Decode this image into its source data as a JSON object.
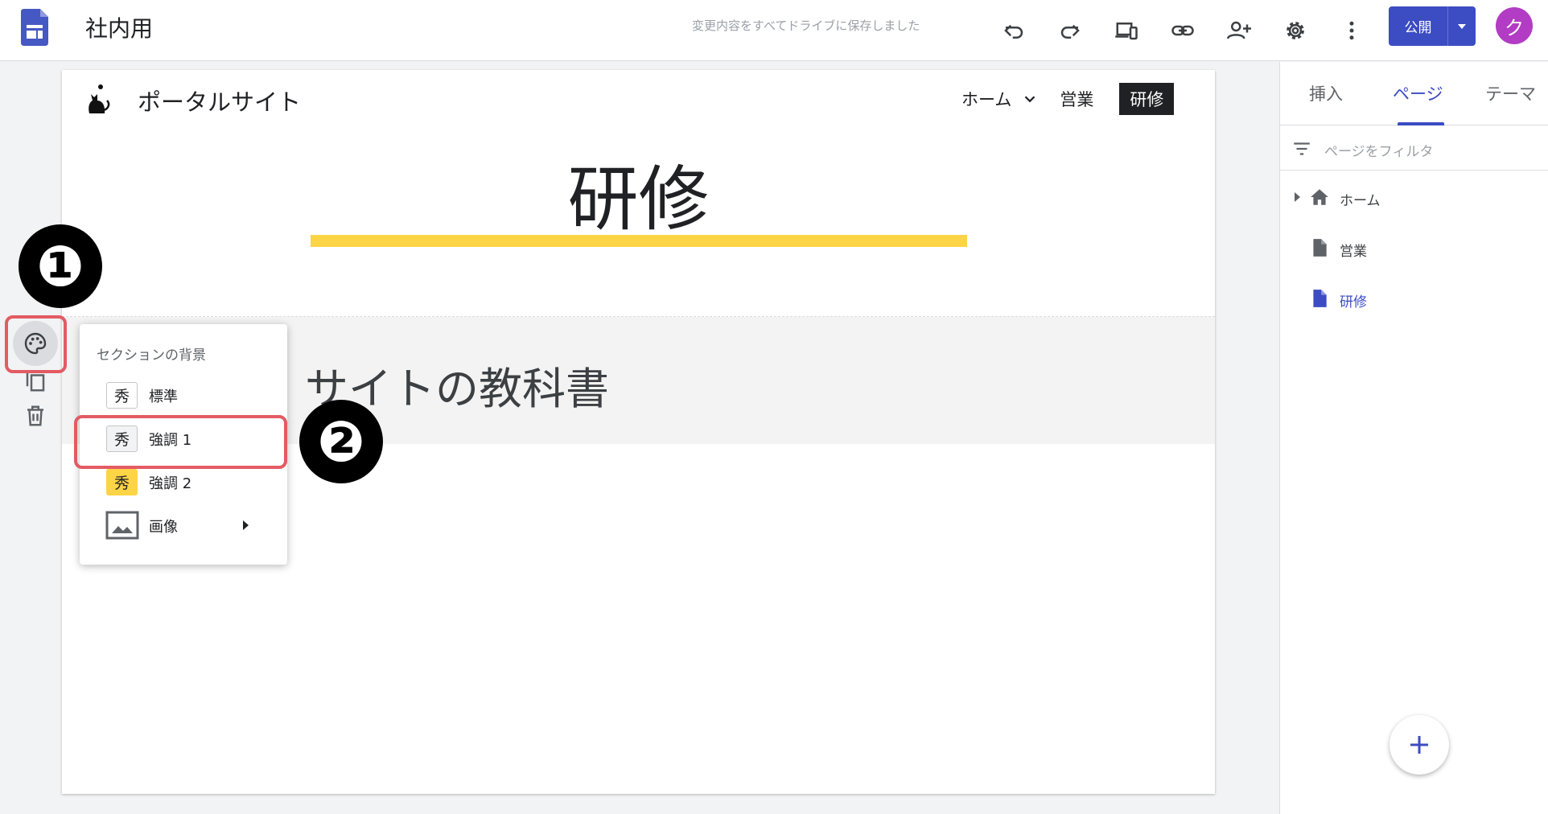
{
  "topbar": {
    "doc_title": "社内用",
    "save_status": "変更内容をすべてドライブに保存しました",
    "publish_label": "公開",
    "avatar_initial": "ク",
    "icons": [
      "undo-icon",
      "redo-icon",
      "preview-devices-icon",
      "link-icon",
      "share-icon",
      "settings-icon",
      "more-icon"
    ]
  },
  "site": {
    "name": "ポータルサイト",
    "nav": {
      "home": "ホーム",
      "sales": "営業",
      "training": "研修"
    },
    "page_heading": "研修",
    "section_text": "サイトの教科書"
  },
  "background_menu": {
    "heading": "セクションの背景",
    "items": [
      {
        "swatch": "秀",
        "label": "標準"
      },
      {
        "swatch": "秀",
        "label": "強調 1"
      },
      {
        "swatch": "秀",
        "label": "強調 2"
      },
      {
        "label": "画像"
      }
    ]
  },
  "markers": {
    "one": "❶",
    "two": "❷"
  },
  "side_panel": {
    "tabs": [
      "挿入",
      "ページ",
      "テーマ"
    ],
    "active_tab": "ページ",
    "filter_placeholder": "ページをフィルタ",
    "pages": [
      {
        "label": "ホーム",
        "icon": "home-icon"
      },
      {
        "label": "営業",
        "icon": "page-icon"
      },
      {
        "label": "研修",
        "icon": "page-icon",
        "active": true
      }
    ],
    "add_button": "+"
  },
  "colors": {
    "accent": "#3c4cc2",
    "highlight_yellow": "#fdd445",
    "callout_red": "#e35b63",
    "avatar": "#b23cc4"
  }
}
